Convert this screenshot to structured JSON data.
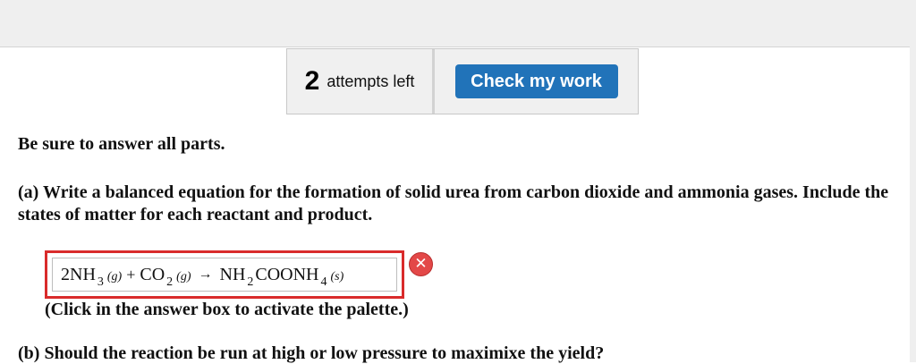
{
  "attempts": {
    "count": "2",
    "label": "attempts left",
    "check_button_label": "Check my work"
  },
  "instruction": "Be sure to answer all parts.",
  "question_a": {
    "text": "(a) Write a balanced equation for the formation of solid urea from carbon dioxide and ammonia gases. Include the states of matter for each reactant and product."
  },
  "equation": {
    "reactant1": "2NH",
    "reactant1_subscript": "3",
    "reactant1_state": "(g)",
    "plus": "+",
    "reactant2": "CO",
    "reactant2_subscript": "2",
    "reactant2_state": "(g)",
    "arrow": "→",
    "product_part1": "NH",
    "product_subscript1": "2",
    "product_part2": "COONH",
    "product_subscript2": "4",
    "product_state": "(s)"
  },
  "error_icon_glyph": "✕",
  "palette_hint": "(Click in the answer box to activate the palette.)",
  "question_b": {
    "text": "(b) Should the reaction be run at high or low pressure to maximixe the yield?"
  },
  "colors": {
    "check_button": "#2173b9",
    "answer_border": "#d92b2b",
    "error_icon": "#e34848",
    "panel_background": "#f0f0f0"
  }
}
